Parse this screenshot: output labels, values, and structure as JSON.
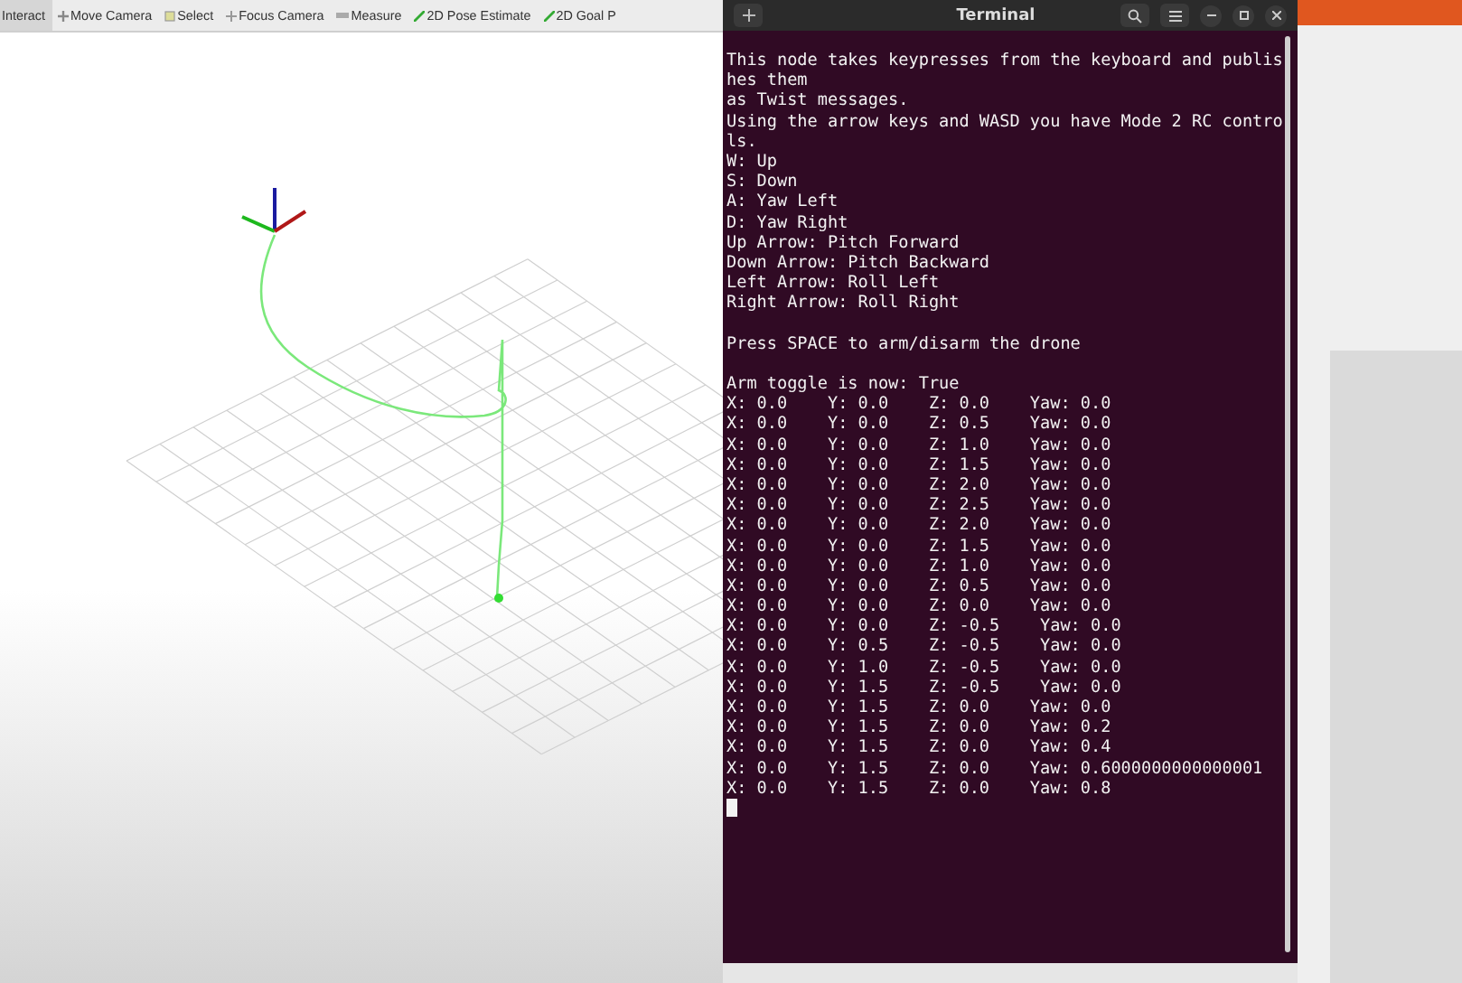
{
  "rviz_toolbar": [
    {
      "label": "Interact",
      "selected": true
    },
    {
      "label": "Move Camera",
      "selected": false
    },
    {
      "label": "Select",
      "selected": false
    },
    {
      "label": "Focus Camera",
      "selected": false
    },
    {
      "label": "Measure",
      "selected": false
    },
    {
      "label": "2D Pose Estimate",
      "selected": false
    },
    {
      "label": "2D Goal P",
      "selected": false
    }
  ],
  "terminal": {
    "title": "Terminal",
    "paragraphs": [
      [
        "This node takes keypresses from the keyboard and publis",
        "hes them",
        "as Twist messages.",
        "Using the arrow keys and WASD you have Mode 2 RC contro",
        "ls.",
        "W: Up",
        "S: Down",
        "A: Yaw Left",
        "D: Yaw Right",
        "Up Arrow: Pitch Forward",
        "Down Arrow: Pitch Backward",
        "Left Arrow: Roll Left",
        "Right Arrow: Roll Right"
      ],
      [
        "Press SPACE to arm/disarm the drone"
      ],
      [
        "Arm toggle is now: True",
        "X: 0.0    Y: 0.0    Z: 0.0    Yaw: 0.0",
        "X: 0.0    Y: 0.0    Z: 0.5    Yaw: 0.0",
        "X: 0.0    Y: 0.0    Z: 1.0    Yaw: 0.0",
        "X: 0.0    Y: 0.0    Z: 1.5    Yaw: 0.0",
        "X: 0.0    Y: 0.0    Z: 2.0    Yaw: 0.0",
        "X: 0.0    Y: 0.0    Z: 2.5    Yaw: 0.0",
        "X: 0.0    Y: 0.0    Z: 2.0    Yaw: 0.0",
        "X: 0.0    Y: 0.0    Z: 1.5    Yaw: 0.0",
        "X: 0.0    Y: 0.0    Z: 1.0    Yaw: 0.0",
        "X: 0.0    Y: 0.0    Z: 0.5    Yaw: 0.0",
        "X: 0.0    Y: 0.0    Z: 0.0    Yaw: 0.0",
        "X: 0.0    Y: 0.0    Z: -0.5    Yaw: 0.0",
        "X: 0.0    Y: 0.5    Z: -0.5    Yaw: 0.0",
        "X: 0.0    Y: 1.0    Z: -0.5    Yaw: 0.0",
        "X: 0.0    Y: 1.5    Z: -0.5    Yaw: 0.0",
        "X: 0.0    Y: 1.5    Z: 0.0    Yaw: 0.0",
        "X: 0.0    Y: 1.5    Z: 0.0    Yaw: 0.2",
        "X: 0.0    Y: 1.5    Z: 0.0    Yaw: 0.4",
        "X: 0.0    Y: 1.5    Z: 0.0    Yaw: 0.6000000000000001",
        "X: 0.0    Y: 1.5    Z: 0.0    Yaw: 0.8"
      ]
    ]
  }
}
